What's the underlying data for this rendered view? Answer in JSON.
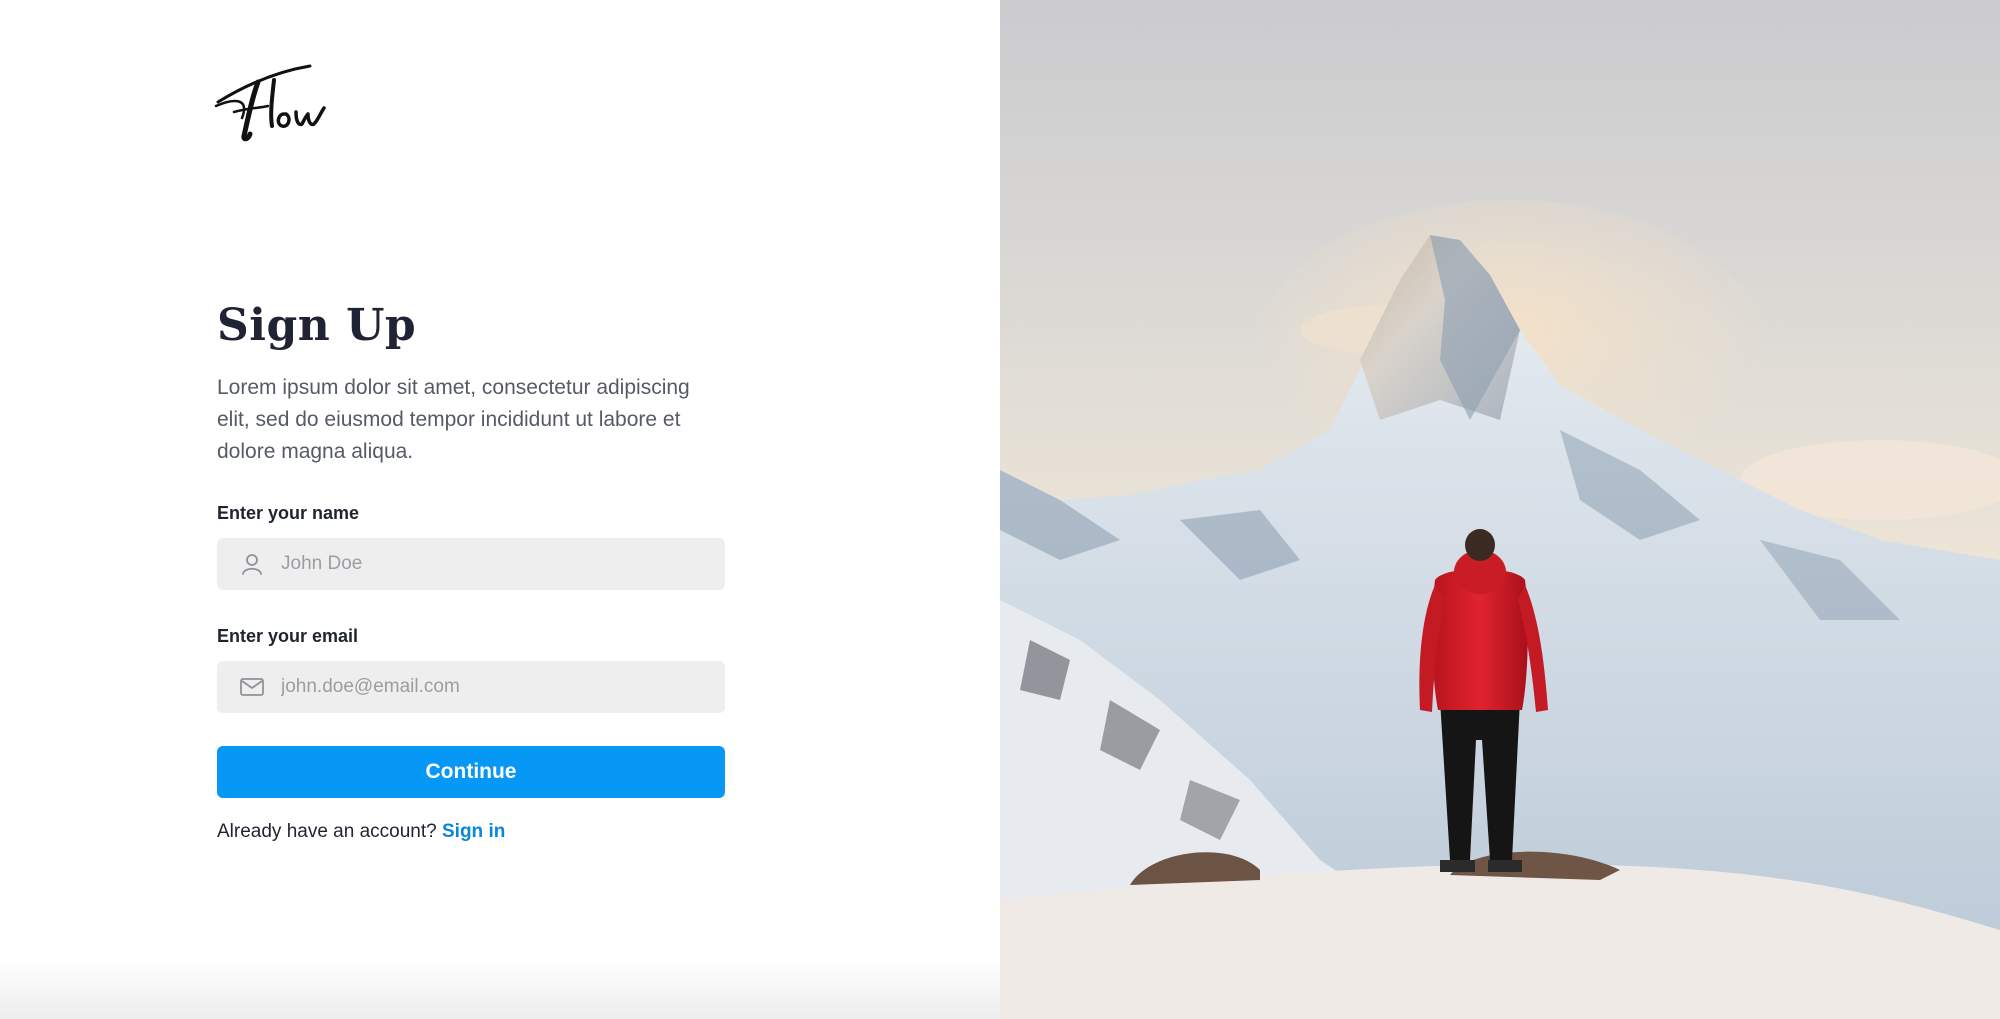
{
  "brand": {
    "logo_text": "Flow",
    "logo_icon": "flow-script-logo"
  },
  "signup": {
    "title": "Sign Up",
    "description": "Lorem ipsum dolor sit amet, consectetur adipiscing elit, sed do eiusmod tempor incididunt ut labore et dolore magna aliqua.",
    "name_label": "Enter your name",
    "name_placeholder": "John Doe",
    "name_value": "",
    "name_icon": "user-icon",
    "email_label": "Enter your email",
    "email_placeholder": "john.doe@email.com",
    "email_value": "",
    "email_icon": "mail-icon",
    "continue_label": "Continue",
    "signin_prompt": "Already have an account?",
    "signin_link": "Sign in"
  },
  "hero": {
    "image_subject": "hiker-mountain-photo"
  },
  "colors": {
    "primary": "#0797f5",
    "link": "#0a86d8",
    "input_bg": "#eeeeee",
    "title": "#1f2333"
  }
}
